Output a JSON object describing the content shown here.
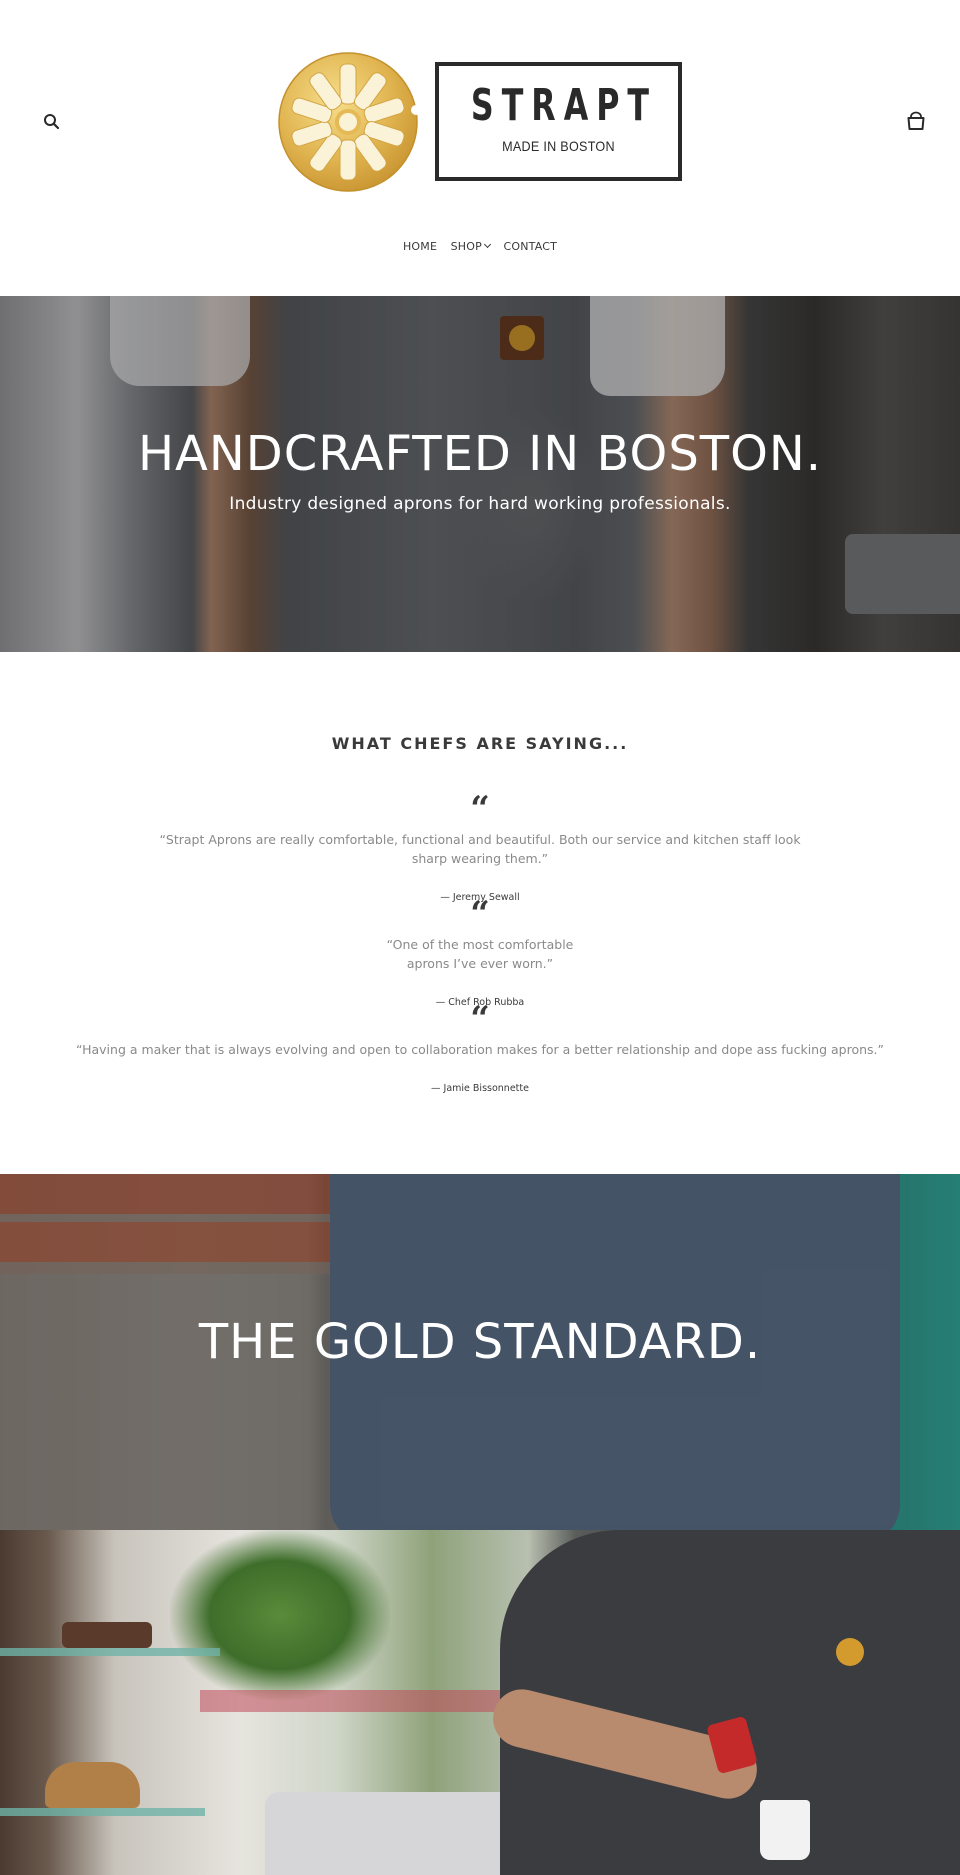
{
  "header": {
    "logo": {
      "title": "STRAPT",
      "tagline": "MADE IN BOSTON"
    },
    "search_icon": "search-icon",
    "cart_icon": "cart-icon"
  },
  "nav": {
    "items": [
      {
        "label": "HOME"
      },
      {
        "label": "SHOP"
      },
      {
        "label": "CONTACT"
      }
    ]
  },
  "hero1": {
    "title": "HANDCRAFTED IN BOSTON.",
    "subtitle": "Industry designed aprons for hard working professionals."
  },
  "testimonials": {
    "title": "WHAT CHEFS ARE SAYING...",
    "items": [
      {
        "quote": "“Strapt Aprons are really comfortable, functional and beautiful. Both our service and kitchen staff look sharp wearing them.”",
        "author": "— Jeremy Sewall"
      },
      {
        "quote": "“One of the most comfortable aprons I’ve ever worn.”",
        "author": "— Chef Rob Rubba"
      },
      {
        "quote": "“Having a maker that is always evolving and open to collaboration makes for a better relationship and dope ass fucking aprons.”",
        "author": "— Jamie Bissonnette"
      }
    ]
  },
  "hero2": {
    "title": "THE GOLD STANDARD."
  },
  "colors": {
    "logo_gold": "#d9a93a",
    "text_dark": "#3a3a3a",
    "quote_gray": "#8a8a8a"
  }
}
